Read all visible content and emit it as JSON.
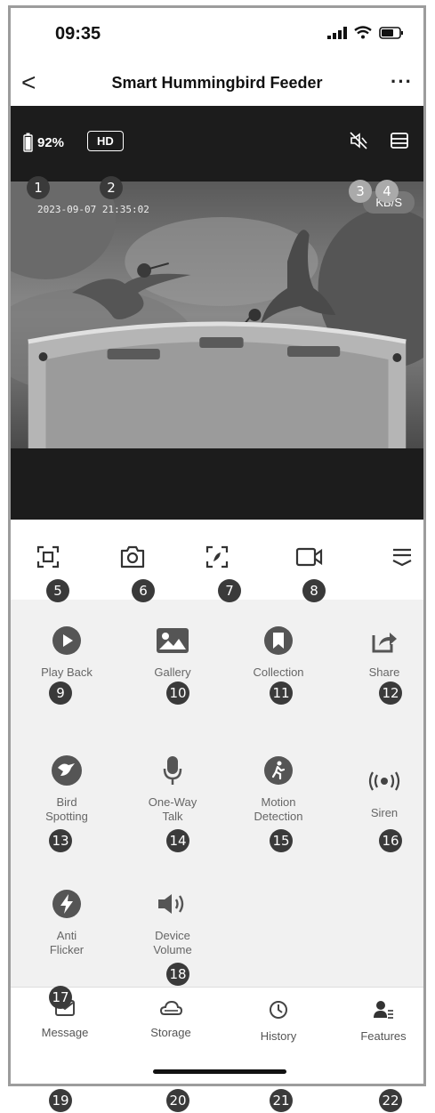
{
  "status": {
    "time": "09:35"
  },
  "nav": {
    "title": "Smart Hummingbird Feeder",
    "back": "<",
    "more": "···"
  },
  "video": {
    "battery": "92%",
    "quality": "HD",
    "timestamp": "2023-09-07  21:35:02",
    "rate": "KB/S"
  },
  "features": {
    "playback": "Play Back",
    "gallery": "Gallery",
    "collection": "Collection",
    "share": "Share",
    "bird1": "Bird",
    "bird2": "Spotting",
    "talk1": "One-Way",
    "talk2": "Talk",
    "motion1": "Motion",
    "motion2": "Detection",
    "siren": "Siren",
    "anti1": "Anti",
    "anti2": "Flicker",
    "vol1": "Device",
    "vol2": "Volume"
  },
  "tabs": {
    "message": "Message",
    "storage": "Storage",
    "history": "History",
    "features": "Features"
  },
  "callouts": [
    "1",
    "2",
    "3",
    "4",
    "5",
    "6",
    "7",
    "8",
    "9",
    "10",
    "11",
    "12",
    "13",
    "14",
    "15",
    "16",
    "17",
    "18",
    "19",
    "20",
    "21",
    "22"
  ]
}
